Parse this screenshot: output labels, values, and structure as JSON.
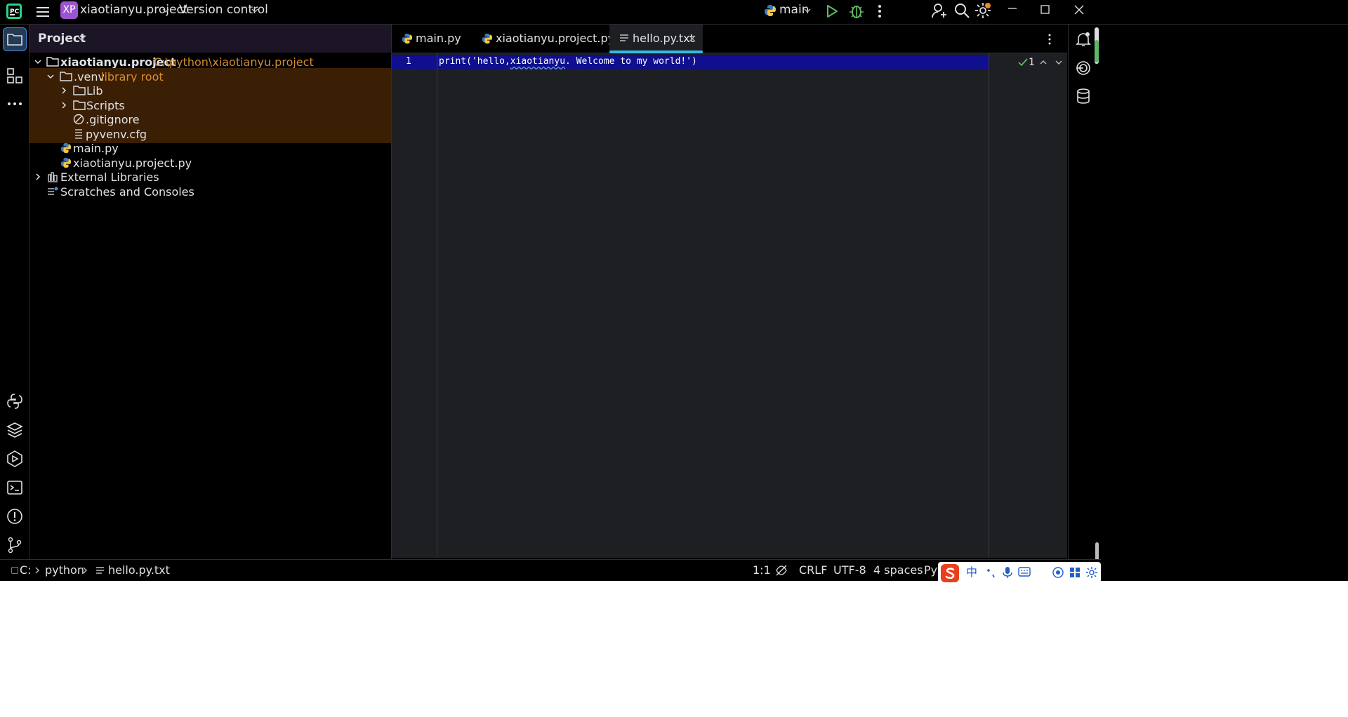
{
  "titlebar": {
    "badge": "XP",
    "project_name": "xiaotianyu.project",
    "vcs_label": "Version control",
    "run_config": "main"
  },
  "project_panel": {
    "title": "Project",
    "tree": {
      "root_name": "xiaotianyu.project",
      "root_path": "C:\\python\\xiaotianyu.project",
      "venv_name": ".venv",
      "venv_sub": "library root",
      "lib": "Lib",
      "scripts": "Scripts",
      "gitignore": ".gitignore",
      "pyvenv": "pyvenv.cfg",
      "main": "main.py",
      "project_py": "xiaotianyu.project.py",
      "external": "External Libraries",
      "scratches": "Scratches and Consoles"
    }
  },
  "tabs": [
    "main.py",
    "xiaotianyu.project.py",
    "hello.py.txt"
  ],
  "editor": {
    "line_number": "1",
    "code_pre": "print('hello,",
    "code_word": "xiaotianyu",
    "code_post": ". Welcome to my world!')",
    "inspection_count": "1"
  },
  "statusbar": {
    "drive": "C:",
    "folder": "python",
    "file": "hello.py.txt",
    "position": "1:1",
    "line_sep": "CRLF",
    "encoding": "UTF-8",
    "indent": "4 spaces",
    "interpreter": "Pyth"
  },
  "ime": {
    "chinese": "中"
  },
  "colors": {
    "accent": "#35b8e8",
    "library_root_bg": "#3a1f05",
    "library_root_text": "#d98c2b",
    "selected_line": "#0f0f8f",
    "badge": "#9c54d0",
    "run_green": "#5fb865"
  }
}
